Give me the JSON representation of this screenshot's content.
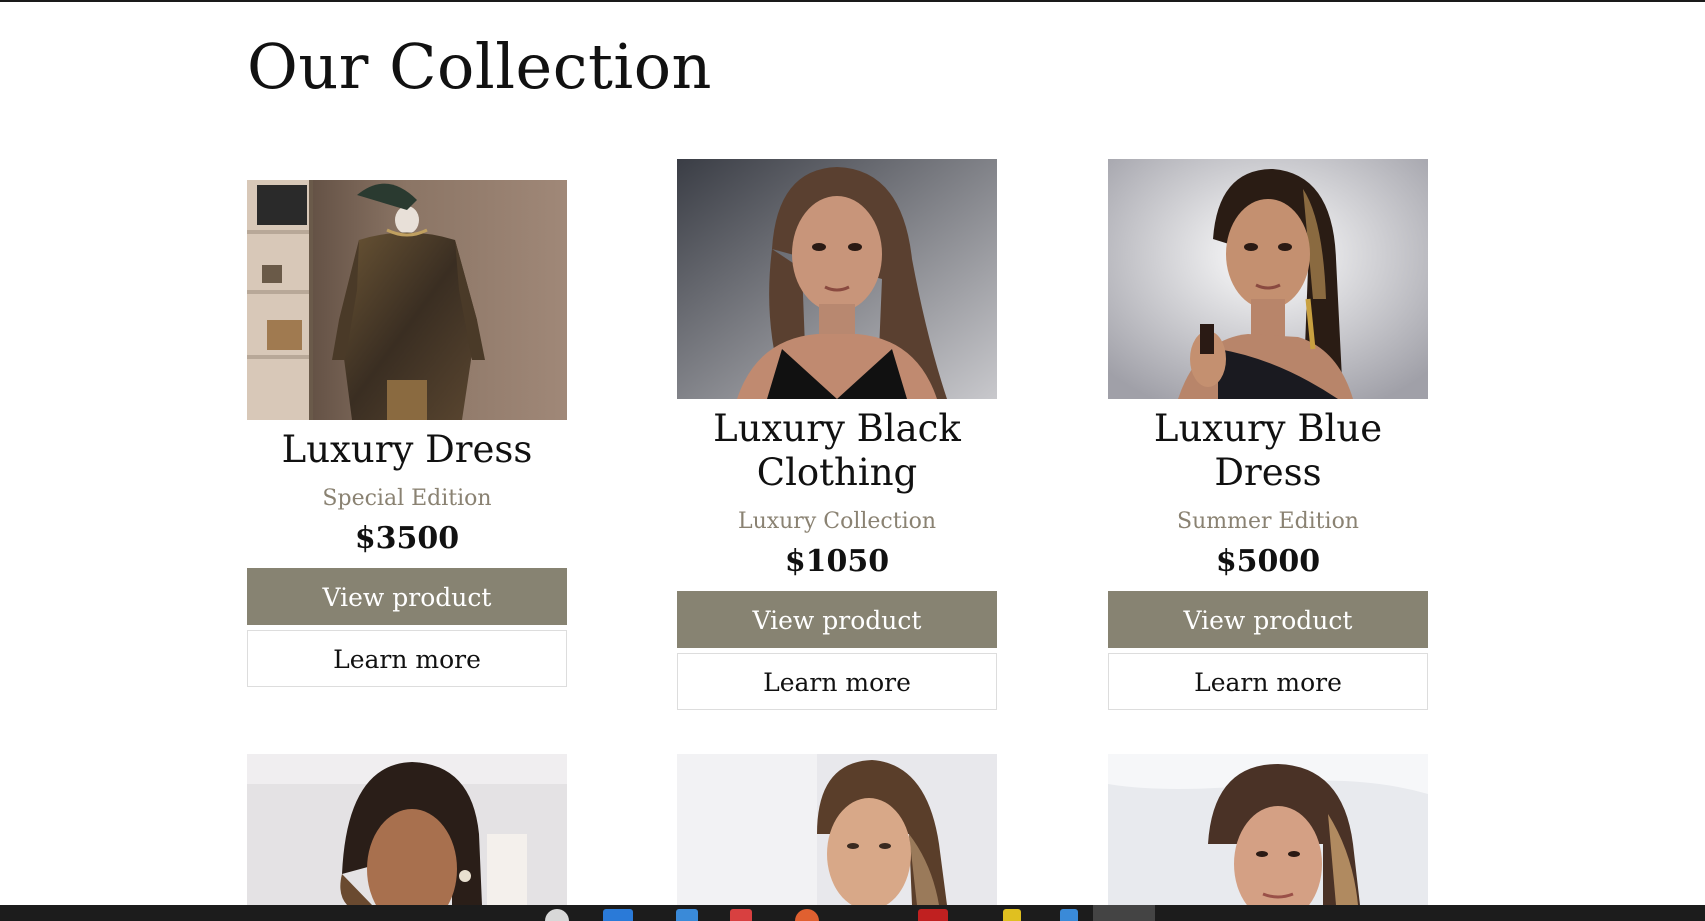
{
  "page": {
    "title": "Our Collection"
  },
  "products": [
    {
      "name": "Luxury Dress",
      "subtitle": "Special Edition",
      "price": "$3500",
      "view_label": "View product",
      "learn_label": "Learn more",
      "image": "dress-on-mannequin"
    },
    {
      "name": "Luxury Black Clothing",
      "subtitle": "Luxury Collection",
      "price": "$1050",
      "view_label": "View product",
      "learn_label": "Learn more",
      "image": "woman-black-dress"
    },
    {
      "name": "Luxury Blue Dress",
      "subtitle": "Summer Edition",
      "price": "$5000",
      "view_label": "View product",
      "learn_label": "Learn more",
      "image": "woman-dark-hair"
    },
    {
      "image": "woman-portrait-4"
    },
    {
      "image": "woman-portrait-5"
    },
    {
      "image": "woman-portrait-6"
    }
  ],
  "colors": {
    "accent_button": "#878372",
    "subtitle": "#8a8272",
    "taskbar": "#1c1c1c"
  }
}
